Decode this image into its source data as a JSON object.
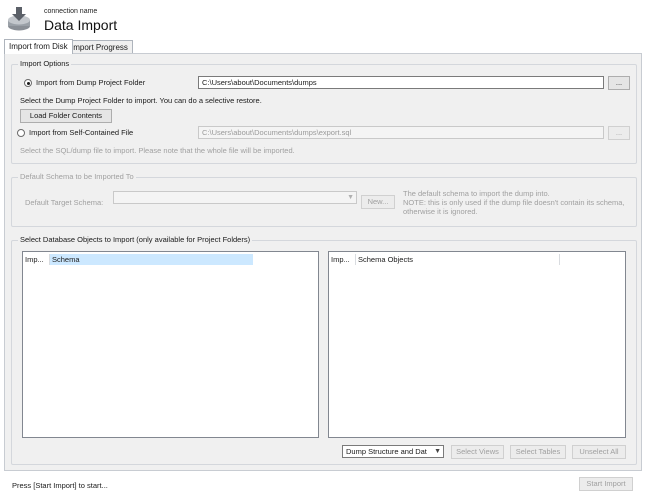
{
  "header": {
    "subtitle": "connection name",
    "title": "Data Import"
  },
  "tabs": [
    {
      "label": "Import from Disk",
      "active": true
    },
    {
      "label": "Import Progress",
      "active": false
    }
  ],
  "import_options": {
    "title": "Import Options",
    "project_folder": {
      "label": "Import from Dump Project Folder",
      "selected": true,
      "path": "C:\\Users\\about\\Documents\\dumps",
      "browse_label": "...",
      "hint": "Select the Dump Project Folder to import. You can do a selective restore.",
      "load_label": "Load Folder Contents"
    },
    "self_contained": {
      "label": "Import from Self-Contained File",
      "selected": false,
      "path": "C:\\Users\\about\\Documents\\dumps\\export.sql",
      "browse_label": "...",
      "hint": "Select the SQL/dump file to import. Please note that the whole file will be imported."
    }
  },
  "default_schema": {
    "title": "Default Schema to be Imported To",
    "target_label": "Default Target Schema:",
    "target_value": "",
    "new_label": "New...",
    "note_line1": "The default schema to import the dump into.",
    "note_line2": "NOTE: this is only used if the dump file doesn't contain its schema,",
    "note_line3": "otherwise it is ignored."
  },
  "objects": {
    "title": "Select Database Objects to Import (only available for Project Folders)",
    "left_columns": [
      "Imp...",
      "Schema"
    ],
    "right_columns": [
      "Imp...",
      "Schema Objects"
    ],
    "dump_select": "Dump Structure and Dat",
    "select_views": "Select Views",
    "select_tables": "Select Tables",
    "unselect_all": "Unselect All"
  },
  "footer": {
    "status": "Press [Start Import] to start...",
    "start_label": "Start Import"
  },
  "colors": {
    "panel_bg": "#f0f0f0",
    "selected_header": "#cce8ff"
  }
}
